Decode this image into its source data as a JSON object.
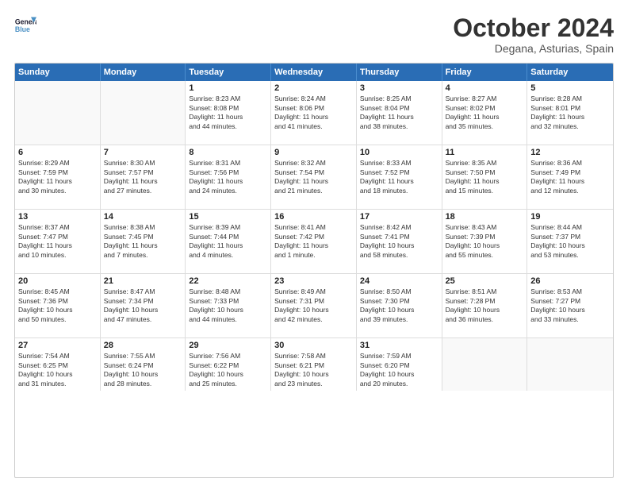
{
  "header": {
    "logo_line1": "General",
    "logo_line2": "Blue",
    "month": "October 2024",
    "location": "Degana, Asturias, Spain"
  },
  "weekdays": [
    "Sunday",
    "Monday",
    "Tuesday",
    "Wednesday",
    "Thursday",
    "Friday",
    "Saturday"
  ],
  "rows": [
    [
      {
        "day": "",
        "lines": []
      },
      {
        "day": "",
        "lines": []
      },
      {
        "day": "1",
        "lines": [
          "Sunrise: 8:23 AM",
          "Sunset: 8:08 PM",
          "Daylight: 11 hours",
          "and 44 minutes."
        ]
      },
      {
        "day": "2",
        "lines": [
          "Sunrise: 8:24 AM",
          "Sunset: 8:06 PM",
          "Daylight: 11 hours",
          "and 41 minutes."
        ]
      },
      {
        "day": "3",
        "lines": [
          "Sunrise: 8:25 AM",
          "Sunset: 8:04 PM",
          "Daylight: 11 hours",
          "and 38 minutes."
        ]
      },
      {
        "day": "4",
        "lines": [
          "Sunrise: 8:27 AM",
          "Sunset: 8:02 PM",
          "Daylight: 11 hours",
          "and 35 minutes."
        ]
      },
      {
        "day": "5",
        "lines": [
          "Sunrise: 8:28 AM",
          "Sunset: 8:01 PM",
          "Daylight: 11 hours",
          "and 32 minutes."
        ]
      }
    ],
    [
      {
        "day": "6",
        "lines": [
          "Sunrise: 8:29 AM",
          "Sunset: 7:59 PM",
          "Daylight: 11 hours",
          "and 30 minutes."
        ]
      },
      {
        "day": "7",
        "lines": [
          "Sunrise: 8:30 AM",
          "Sunset: 7:57 PM",
          "Daylight: 11 hours",
          "and 27 minutes."
        ]
      },
      {
        "day": "8",
        "lines": [
          "Sunrise: 8:31 AM",
          "Sunset: 7:56 PM",
          "Daylight: 11 hours",
          "and 24 minutes."
        ]
      },
      {
        "day": "9",
        "lines": [
          "Sunrise: 8:32 AM",
          "Sunset: 7:54 PM",
          "Daylight: 11 hours",
          "and 21 minutes."
        ]
      },
      {
        "day": "10",
        "lines": [
          "Sunrise: 8:33 AM",
          "Sunset: 7:52 PM",
          "Daylight: 11 hours",
          "and 18 minutes."
        ]
      },
      {
        "day": "11",
        "lines": [
          "Sunrise: 8:35 AM",
          "Sunset: 7:50 PM",
          "Daylight: 11 hours",
          "and 15 minutes."
        ]
      },
      {
        "day": "12",
        "lines": [
          "Sunrise: 8:36 AM",
          "Sunset: 7:49 PM",
          "Daylight: 11 hours",
          "and 12 minutes."
        ]
      }
    ],
    [
      {
        "day": "13",
        "lines": [
          "Sunrise: 8:37 AM",
          "Sunset: 7:47 PM",
          "Daylight: 11 hours",
          "and 10 minutes."
        ]
      },
      {
        "day": "14",
        "lines": [
          "Sunrise: 8:38 AM",
          "Sunset: 7:45 PM",
          "Daylight: 11 hours",
          "and 7 minutes."
        ]
      },
      {
        "day": "15",
        "lines": [
          "Sunrise: 8:39 AM",
          "Sunset: 7:44 PM",
          "Daylight: 11 hours",
          "and 4 minutes."
        ]
      },
      {
        "day": "16",
        "lines": [
          "Sunrise: 8:41 AM",
          "Sunset: 7:42 PM",
          "Daylight: 11 hours",
          "and 1 minute."
        ]
      },
      {
        "day": "17",
        "lines": [
          "Sunrise: 8:42 AM",
          "Sunset: 7:41 PM",
          "Daylight: 10 hours",
          "and 58 minutes."
        ]
      },
      {
        "day": "18",
        "lines": [
          "Sunrise: 8:43 AM",
          "Sunset: 7:39 PM",
          "Daylight: 10 hours",
          "and 55 minutes."
        ]
      },
      {
        "day": "19",
        "lines": [
          "Sunrise: 8:44 AM",
          "Sunset: 7:37 PM",
          "Daylight: 10 hours",
          "and 53 minutes."
        ]
      }
    ],
    [
      {
        "day": "20",
        "lines": [
          "Sunrise: 8:45 AM",
          "Sunset: 7:36 PM",
          "Daylight: 10 hours",
          "and 50 minutes."
        ]
      },
      {
        "day": "21",
        "lines": [
          "Sunrise: 8:47 AM",
          "Sunset: 7:34 PM",
          "Daylight: 10 hours",
          "and 47 minutes."
        ]
      },
      {
        "day": "22",
        "lines": [
          "Sunrise: 8:48 AM",
          "Sunset: 7:33 PM",
          "Daylight: 10 hours",
          "and 44 minutes."
        ]
      },
      {
        "day": "23",
        "lines": [
          "Sunrise: 8:49 AM",
          "Sunset: 7:31 PM",
          "Daylight: 10 hours",
          "and 42 minutes."
        ]
      },
      {
        "day": "24",
        "lines": [
          "Sunrise: 8:50 AM",
          "Sunset: 7:30 PM",
          "Daylight: 10 hours",
          "and 39 minutes."
        ]
      },
      {
        "day": "25",
        "lines": [
          "Sunrise: 8:51 AM",
          "Sunset: 7:28 PM",
          "Daylight: 10 hours",
          "and 36 minutes."
        ]
      },
      {
        "day": "26",
        "lines": [
          "Sunrise: 8:53 AM",
          "Sunset: 7:27 PM",
          "Daylight: 10 hours",
          "and 33 minutes."
        ]
      }
    ],
    [
      {
        "day": "27",
        "lines": [
          "Sunrise: 7:54 AM",
          "Sunset: 6:25 PM",
          "Daylight: 10 hours",
          "and 31 minutes."
        ]
      },
      {
        "day": "28",
        "lines": [
          "Sunrise: 7:55 AM",
          "Sunset: 6:24 PM",
          "Daylight: 10 hours",
          "and 28 minutes."
        ]
      },
      {
        "day": "29",
        "lines": [
          "Sunrise: 7:56 AM",
          "Sunset: 6:22 PM",
          "Daylight: 10 hours",
          "and 25 minutes."
        ]
      },
      {
        "day": "30",
        "lines": [
          "Sunrise: 7:58 AM",
          "Sunset: 6:21 PM",
          "Daylight: 10 hours",
          "and 23 minutes."
        ]
      },
      {
        "day": "31",
        "lines": [
          "Sunrise: 7:59 AM",
          "Sunset: 6:20 PM",
          "Daylight: 10 hours",
          "and 20 minutes."
        ]
      },
      {
        "day": "",
        "lines": []
      },
      {
        "day": "",
        "lines": []
      }
    ]
  ]
}
